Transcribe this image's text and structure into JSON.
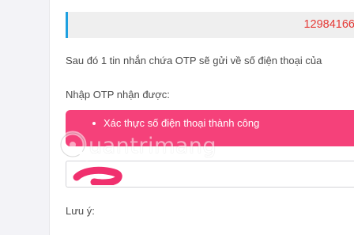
{
  "otp_box": {
    "code": "12984166"
  },
  "instruction_text": "Sau đó 1 tin nhắn chứa OTP sẽ gửi về số điện thoại của",
  "otp_label": "Nhập OTP nhận được:",
  "alert": {
    "message": "Xác thực số điện thoại thành công",
    "background": "#f5417a"
  },
  "otp_input": {
    "value": ""
  },
  "note_label": "Lưu ý:",
  "watermark": {
    "text": "uantrimang"
  },
  "colors": {
    "accent_border": "#1ea0e0",
    "code_color": "#e53935"
  }
}
